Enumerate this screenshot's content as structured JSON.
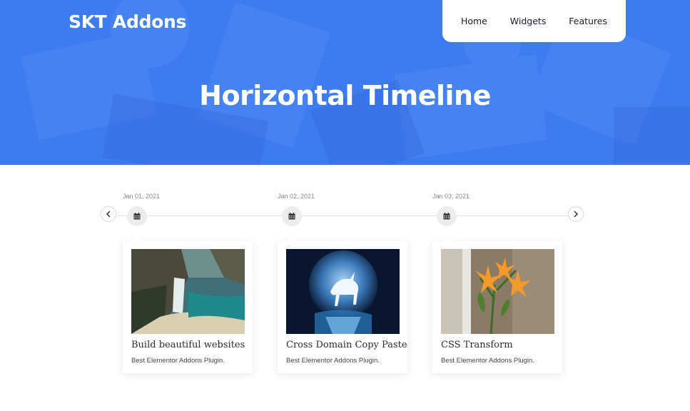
{
  "header": {
    "brand": "SKT Addons",
    "nav": [
      "Home",
      "Widgets",
      "Features"
    ],
    "page_title": "Horizontal Timeline"
  },
  "timeline": {
    "items": [
      {
        "date": "Jan 01, 2021",
        "title": "Build beautiful websites",
        "text": "Best Elementor Addons Plugin."
      },
      {
        "date": "Jan 02, 2021",
        "title": "Cross Domain Copy Paste",
        "text": "Best Elementor Addons Plugin."
      },
      {
        "date": "Jan 03, 2021",
        "title": "CSS Transform",
        "text": "Best Elementor Addons Plugin."
      }
    ]
  },
  "colors": {
    "hero": "#3f7ef0",
    "nav_bg": "#ffffff"
  },
  "icons": [
    "calendar-icon",
    "chevron-left-icon",
    "chevron-right-icon"
  ]
}
